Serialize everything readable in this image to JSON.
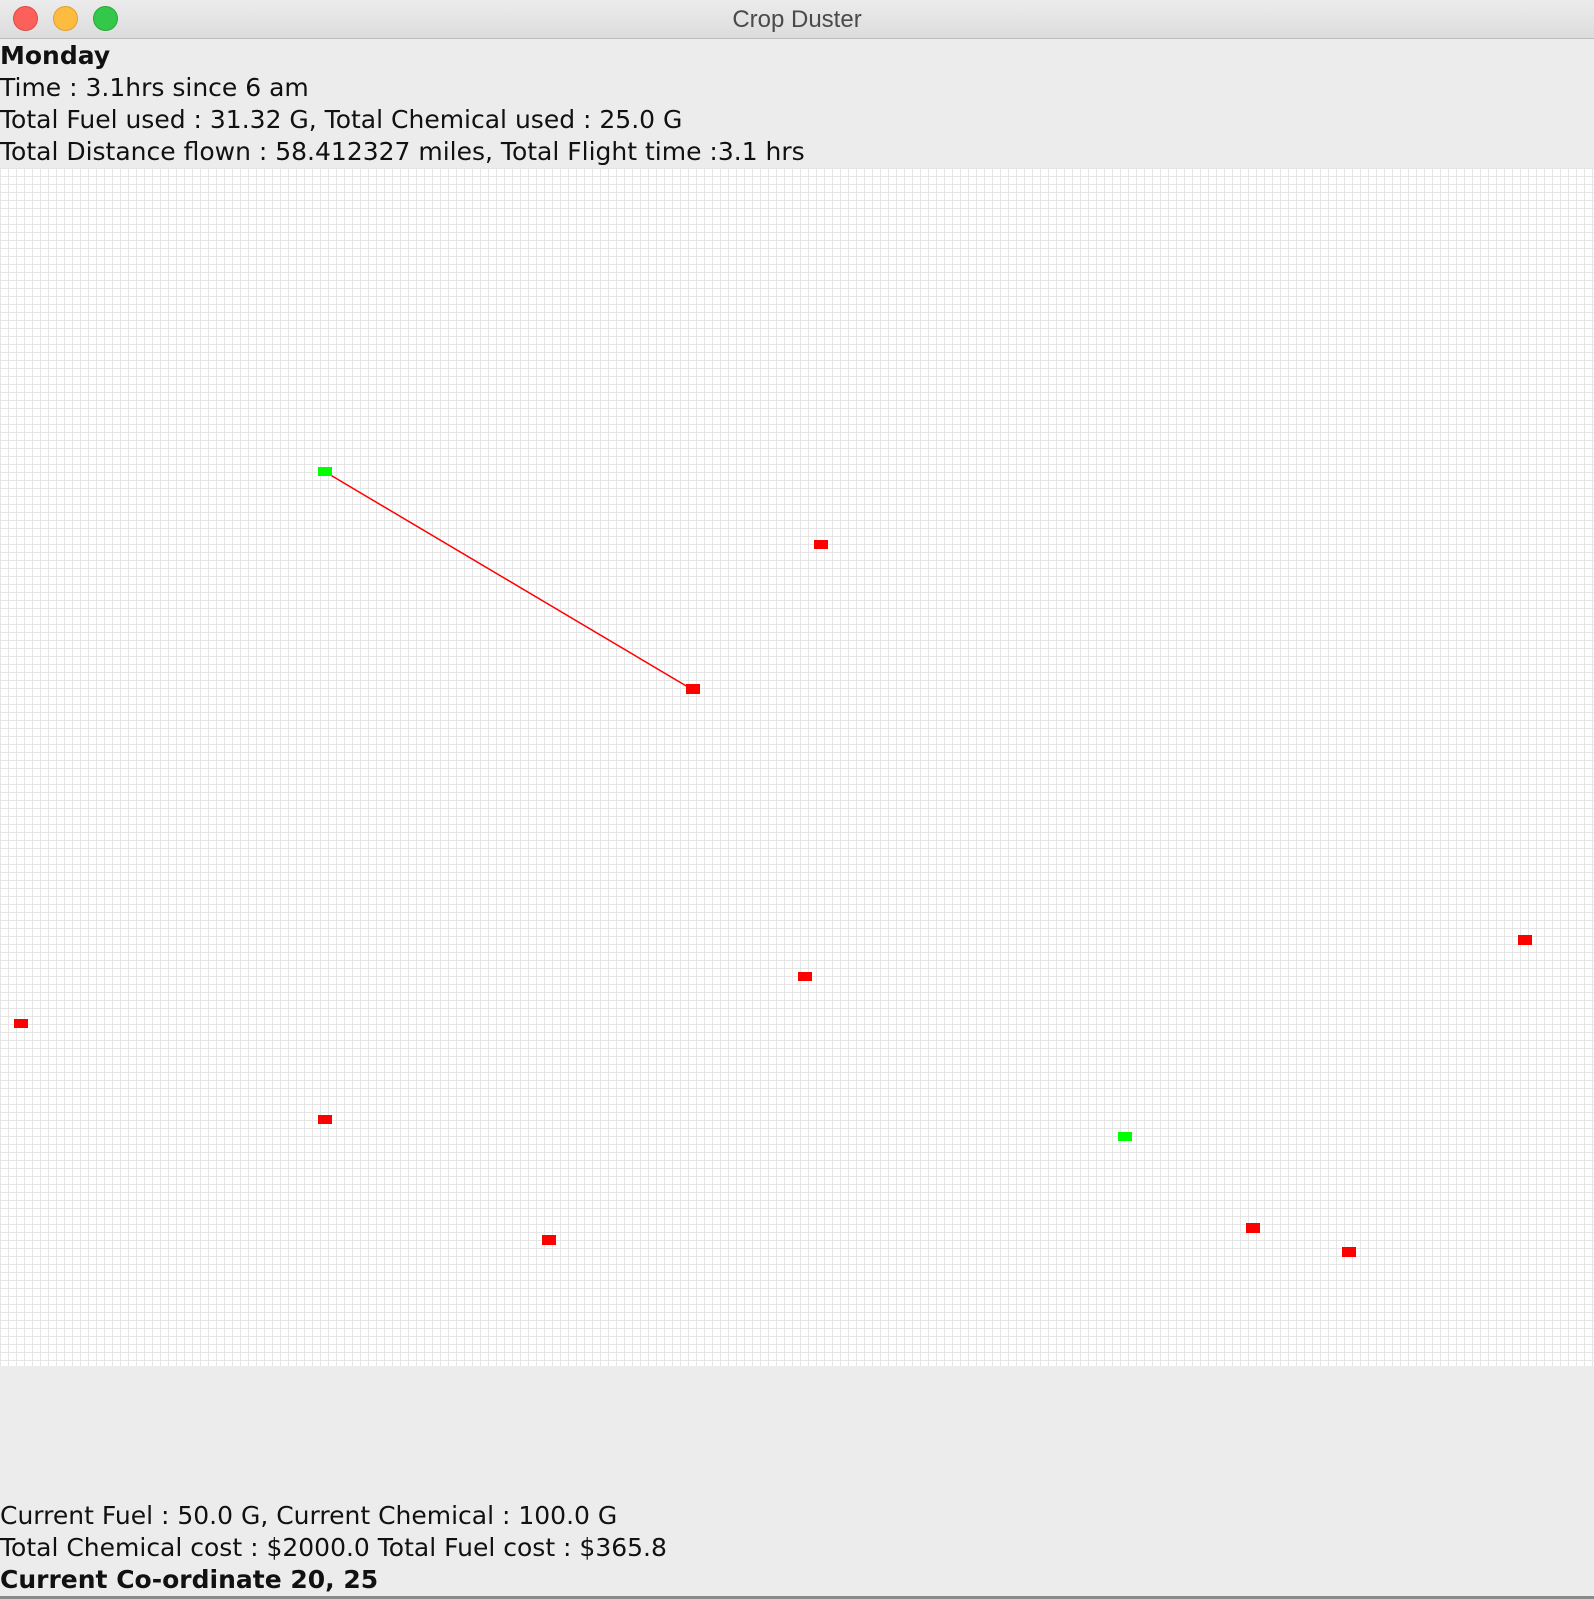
{
  "window": {
    "title": "Crop Duster",
    "controls": [
      "close",
      "minimize",
      "maximize"
    ]
  },
  "header": {
    "day": "Monday",
    "time": "Time : 3.1hrs since 6 am",
    "totals_line1": "Total Fuel used : 31.32 G, Total Chemical used : 25.0 G",
    "totals_line2": "Total Distance flown : 58.412327 miles, Total Flight time :3.1 hrs"
  },
  "footer": {
    "current_line": "Current Fuel : 50.0 G, Current Chemical : 100.0 G",
    "cost_line": "Total Chemical cost : $2000.0 Total Fuel cost : $365.8",
    "coordinate_line": "Current Co-ordinate 20, 25"
  },
  "map": {
    "colors": {
      "field": "#ff0000",
      "base": "#00ff00",
      "path": "#ff0000",
      "grid_line": "#e6e6e6"
    }
  }
}
